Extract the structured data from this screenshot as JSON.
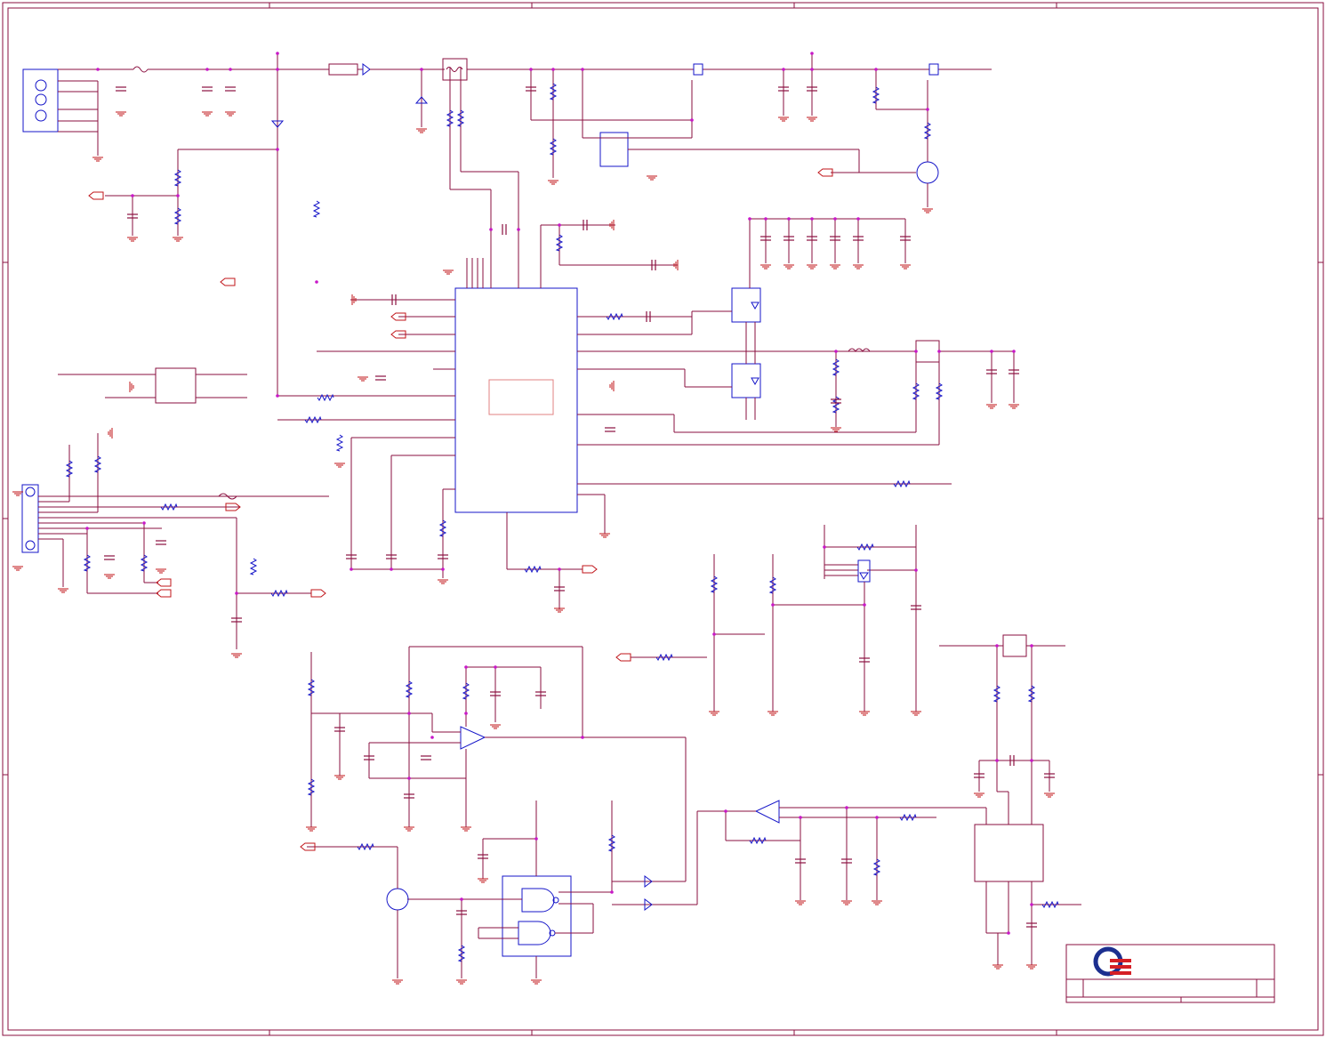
{
  "sheet": {
    "title": "",
    "colors": {
      "wire": "#8a0f3f",
      "ground": "#c0141a",
      "part": "#1414c8",
      "junction": "#c818c8",
      "logo_red": "#d51f26",
      "logo_blue": "#1c2f8f"
    }
  },
  "title_block": {
    "logo": "company-logo-icon",
    "company_name": "",
    "sheet_title": ""
  }
}
